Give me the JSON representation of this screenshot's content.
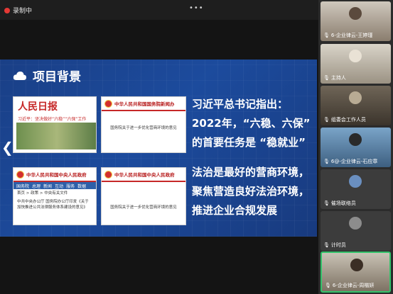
{
  "recording": {
    "label": "录制中"
  },
  "more_label": "•••",
  "slide": {
    "title": "项目背景",
    "prev_arrow": "❮",
    "newspaper": {
      "masthead": "人民日报",
      "headline": "习近平：坚决做好“六稳”“六保”工作"
    },
    "gov_site_name": "中华人民共和国中央人民政府",
    "gov_site_name_alt": "中华人民共和国国务院新闻办",
    "gov_nav": [
      "国务院",
      "总理",
      "新闻",
      "互动",
      "服务",
      "数据"
    ],
    "gov_doc_title": "中共中央办公厅 国务院办公厅印发《关于加快推进公共法律服务体系建设的意见》",
    "gov_doc_short": "首页 > 政策 > 中央有关文件",
    "gov_doc_2_text": "国务院关于进一步优化营商环境的意见",
    "text1": [
      "习近平总书记指出：",
      "2022年，“六稳、六保”",
      "的首要任务是 “稳就业”"
    ],
    "text2": [
      "法治是最好的营商环境，",
      "聚焦营造良好法治环境，",
      "推进企业合规发展"
    ]
  },
  "participants": [
    {
      "label": "6-企业律云-王婷瑾",
      "icon": "mic-icon"
    },
    {
      "label": "主持人",
      "icon": "mic-icon"
    },
    {
      "label": "组委会工作人员",
      "icon": "mic-icon"
    },
    {
      "label": "6@-企业律云-石应章",
      "icon": "mic-icon"
    },
    {
      "label": "催场联络员",
      "icon": "mic-icon"
    },
    {
      "label": "计时员",
      "icon": "mic-icon"
    },
    {
      "label": "6-企业律云-周楷妍",
      "icon": "mic-icon"
    }
  ]
}
